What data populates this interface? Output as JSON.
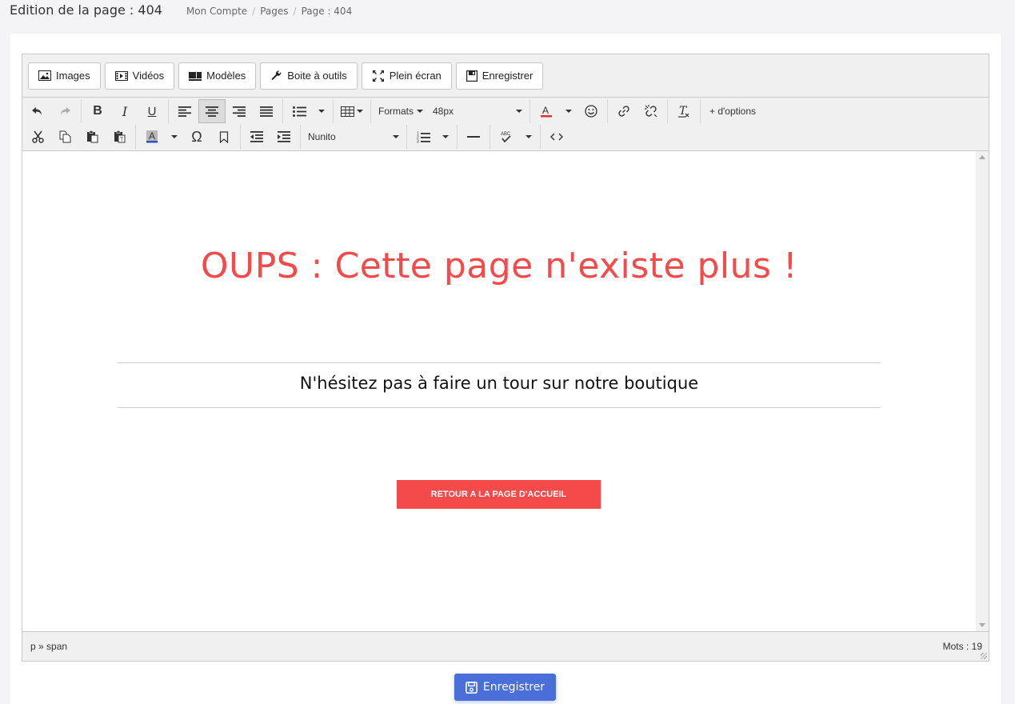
{
  "header": {
    "title": "Edition de la page : 404",
    "breadcrumb": [
      "Mon Compte",
      "Pages",
      "Page : 404"
    ]
  },
  "menubar": {
    "images": "Images",
    "videos": "Vidéos",
    "modeles": "Modèles",
    "outils": "Boite à outils",
    "plein_ecran": "Plein écran",
    "enregistrer": "Enregistrer"
  },
  "toolbar": {
    "formats": "Formats",
    "font_size": "48px",
    "font_family": "Nunito",
    "more_options": "+ d'options",
    "spell_label": "ABC"
  },
  "content": {
    "headline": "OUPS : Cette page n'existe plus !",
    "subtext": "N'hésitez pas à faire un tour sur notre boutique",
    "cta": "RETOUR A LA PAGE D'ACCUEIL"
  },
  "statusbar": {
    "path": "p » span",
    "word_count": "Mots : 19"
  },
  "footer": {
    "save": "Enregistrer"
  },
  "colors": {
    "accent_red": "#f44a4a",
    "primary_blue": "#4a6fd8"
  }
}
